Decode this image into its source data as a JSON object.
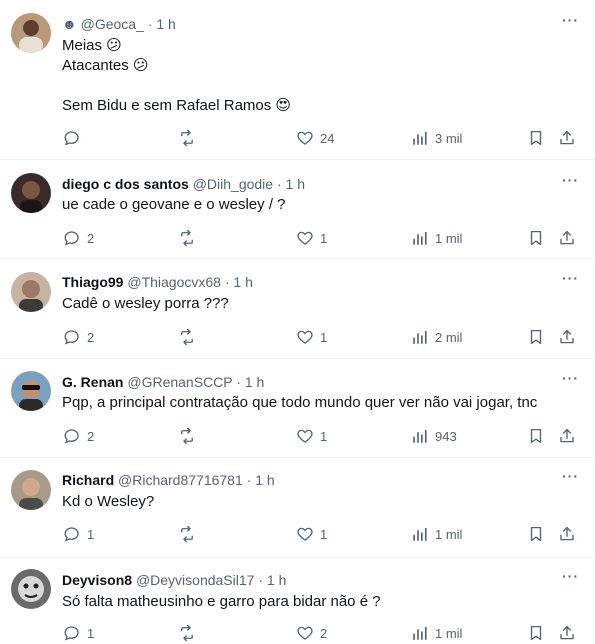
{
  "tweets": [
    {
      "name": "",
      "handle": "☻ @Geoca_",
      "time": "1 h",
      "dot": "·",
      "lines": [
        "Meias 😕",
        "Atacantes 😕",
        "",
        "Sem Bidu e sem Rafael Ramos 😍"
      ],
      "reply_count": "",
      "retweet_count": "",
      "like_count": "24",
      "view_count": "3 mil",
      "avatar_color": "#b89a7a"
    },
    {
      "name": "diego c dos santos",
      "handle": "@Diih_godie",
      "time": "1 h",
      "dot": "·",
      "lines": [
        "ue cade o geovane e o wesley / ?"
      ],
      "reply_count": "2",
      "retweet_count": "",
      "like_count": "1",
      "view_count": "1 mil",
      "avatar_color": "#3a2a2a"
    },
    {
      "name": "Thiago99",
      "handle": "@Thiagocvx68",
      "time": "1 h",
      "dot": "·",
      "lines": [
        "Cadê o wesley porra ???"
      ],
      "reply_count": "2",
      "retweet_count": "",
      "like_count": "1",
      "view_count": "2 mil",
      "avatar_color": "#c8b2a0"
    },
    {
      "name": "G. Renan",
      "handle": "@GRenanSCCP",
      "time": "1 h",
      "dot": "·",
      "lines": [
        "Pqp, a principal contratação que todo mundo quer ver não vai jogar, tnc"
      ],
      "reply_count": "2",
      "retweet_count": "",
      "like_count": "1",
      "view_count": "943",
      "avatar_color": "#7da0c0"
    },
    {
      "name": "Richard",
      "handle": "@Richard87716781",
      "time": "1 h",
      "dot": "·",
      "lines": [
        "Kd o Wesley?"
      ],
      "reply_count": "1",
      "retweet_count": "",
      "like_count": "1",
      "view_count": "1 mil",
      "avatar_color": "#a89a88"
    },
    {
      "name": "Deyvison8",
      "handle": "@DeyvisondaSil17",
      "time": "1 h",
      "dot": "·",
      "lines": [
        "Só falta matheusinho e garro para bidar não é ?"
      ],
      "reply_count": "1",
      "retweet_count": "",
      "like_count": "2",
      "view_count": "1 mil",
      "avatar_color": "#6a6a6a"
    }
  ],
  "colors": {
    "text": "#0f1419",
    "secondary": "#536471",
    "divider": "#eff3f4"
  },
  "icons": {
    "reply": "reply-icon",
    "retweet": "retweet-icon",
    "like": "like-icon",
    "views": "views-icon",
    "bookmark": "bookmark-icon",
    "share": "share-icon",
    "more": "more-options-icon"
  }
}
